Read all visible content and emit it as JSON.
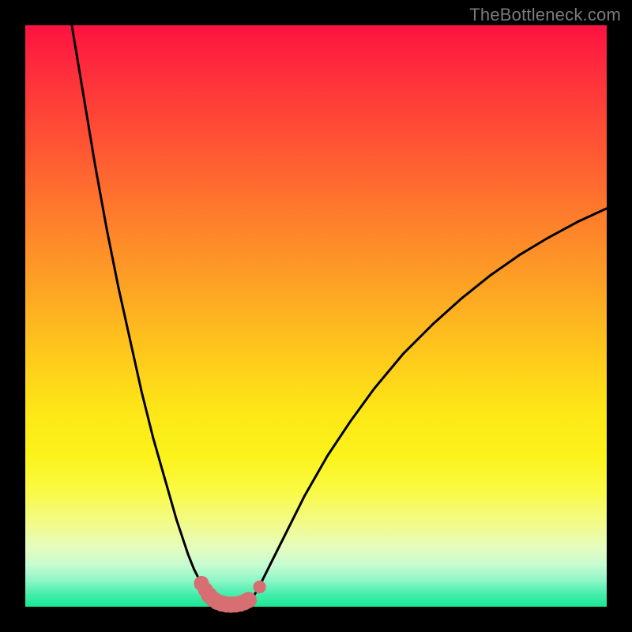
{
  "watermark": "TheBottleneck.com",
  "colors": {
    "frame": "#000000",
    "gradient_top": "#fd1240",
    "gradient_bottom": "#17e793",
    "curve": "#000000",
    "marker": "#d76e71"
  },
  "chart_data": {
    "type": "line",
    "title": "",
    "xlabel": "",
    "ylabel": "",
    "xlim": [
      0,
      100
    ],
    "ylim": [
      0,
      100
    ],
    "grid": false,
    "series": [
      {
        "name": "left-branch",
        "x": [
          8,
          10,
          12,
          14,
          16,
          18,
          20,
          22,
          24,
          26,
          27,
          28,
          29,
          30,
          31,
          32,
          32.8
        ],
        "y": [
          100,
          88,
          76,
          65,
          55,
          46,
          37,
          29,
          22,
          15,
          12,
          9,
          6.5,
          4.5,
          3,
          1.8,
          1.2
        ]
      },
      {
        "name": "trough",
        "x": [
          32.8,
          34,
          35,
          36,
          37,
          38,
          38.8
        ],
        "y": [
          1.2,
          0.6,
          0.4,
          0.35,
          0.4,
          0.6,
          1.1
        ]
      },
      {
        "name": "right-branch",
        "x": [
          38.8,
          40,
          42,
          45,
          48,
          52,
          56,
          60,
          65,
          70,
          75,
          80,
          85,
          90,
          95,
          100
        ],
        "y": [
          1.1,
          3,
          7,
          13,
          19,
          26,
          32,
          37.5,
          43.5,
          48.5,
          53,
          57,
          60.5,
          63.5,
          66.2,
          68.5
        ]
      }
    ],
    "markers": {
      "name": "highlight-dots",
      "color": "#d76e71",
      "points": [
        {
          "x": 30.3,
          "y": 4.0,
          "r": 1.3
        },
        {
          "x": 31.0,
          "y": 2.9,
          "r": 1.3
        },
        {
          "x": 31.6,
          "y": 2.0,
          "r": 1.4
        },
        {
          "x": 32.3,
          "y": 1.3,
          "r": 1.4
        },
        {
          "x": 33.0,
          "y": 0.85,
          "r": 1.4
        },
        {
          "x": 33.8,
          "y": 0.55,
          "r": 1.4
        },
        {
          "x": 34.6,
          "y": 0.4,
          "r": 1.4
        },
        {
          "x": 35.4,
          "y": 0.35,
          "r": 1.4
        },
        {
          "x": 36.2,
          "y": 0.4,
          "r": 1.4
        },
        {
          "x": 37.0,
          "y": 0.55,
          "r": 1.4
        },
        {
          "x": 37.7,
          "y": 0.8,
          "r": 1.4
        },
        {
          "x": 38.4,
          "y": 1.15,
          "r": 1.4
        },
        {
          "x": 40.3,
          "y": 3.4,
          "r": 1.1
        }
      ]
    }
  }
}
